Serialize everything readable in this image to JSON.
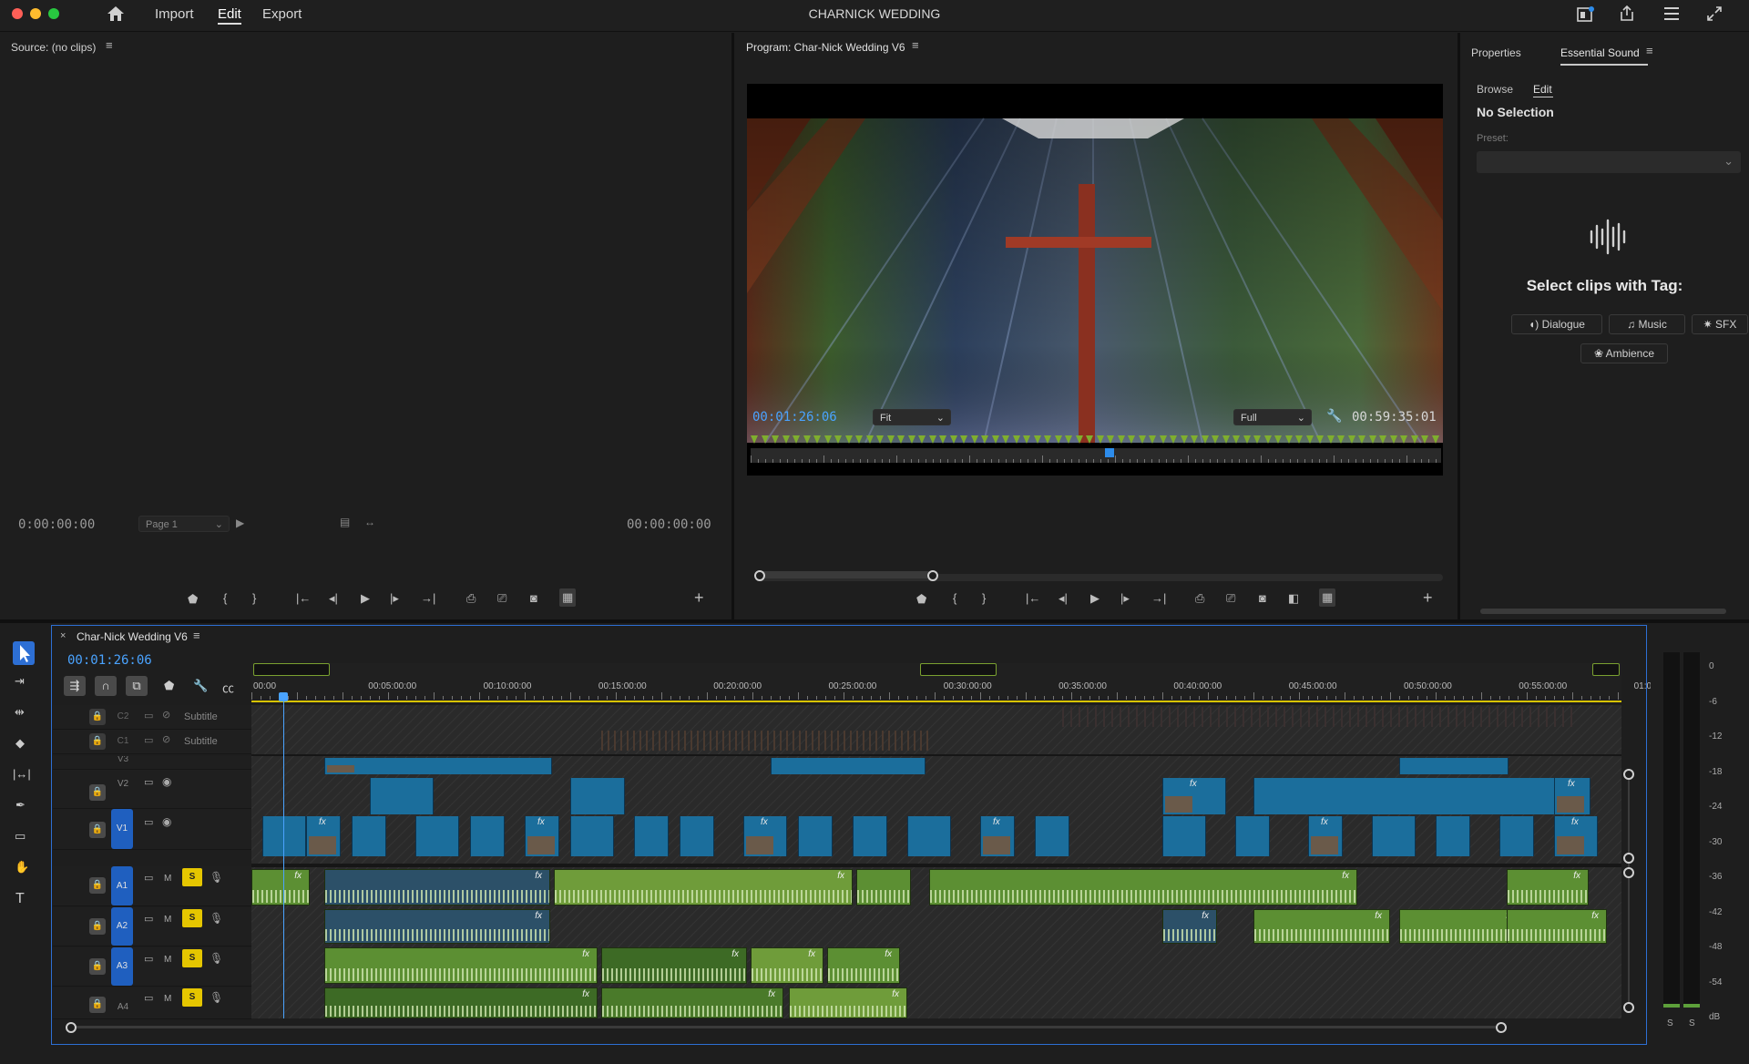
{
  "titlebar": {
    "menu": {
      "import": "Import",
      "edit": "Edit",
      "export": "Export"
    },
    "project_title": "CHARNICK WEDDING",
    "icons": [
      "home-icon",
      "quick-export-icon",
      "share-icon",
      "workspaces-icon",
      "fullscreen-icon"
    ]
  },
  "source_monitor": {
    "title": "Source: (no clips)",
    "timecode_in": "0:00:00:00",
    "timecode_out": "00:00:00:00",
    "page_dropdown": "Page 1"
  },
  "program_monitor": {
    "title": "Program: Char-Nick Wedding V6",
    "timecode_current": "00:01:26:06",
    "zoom_dropdown": "Fit",
    "resolution_dropdown": "Full",
    "duration": "00:59:35:01",
    "playhead_fraction": 0.52
  },
  "essential_sound": {
    "tabs": {
      "properties": "Properties",
      "essential_sound": "Essential Sound"
    },
    "subtabs": {
      "browse": "Browse",
      "edit": "Edit"
    },
    "no_selection": "No Selection",
    "preset_label": "Preset:",
    "select_heading": "Select clips with Tag:",
    "tags": {
      "dialogue": "Dialogue",
      "music": "Music",
      "sfx": "SFX",
      "ambience": "Ambience"
    }
  },
  "timeline": {
    "sequence_tab": "Char-Nick Wedding V6",
    "timecode": "00:01:26:06",
    "ruler_labels": [
      "00:00",
      "00:05:00:00",
      "00:10:00:00",
      "00:15:00:00",
      "00:20:00:00",
      "00:25:00:00",
      "00:30:00:00",
      "00:35:00:00",
      "00:40:00:00",
      "00:45:00:00",
      "00:50:00:00",
      "00:55:00:00",
      "01:0"
    ],
    "tracks": {
      "c2": {
        "name": "C2",
        "label": "Subtitle"
      },
      "c1": {
        "name": "C1",
        "label": "Subtitle"
      },
      "v3": {
        "name": "V3"
      },
      "v2": {
        "name": "V2"
      },
      "v1": {
        "name": "V1"
      },
      "a1": {
        "name": "A1",
        "m": "M",
        "s": "S"
      },
      "a2": {
        "name": "A2",
        "m": "M",
        "s": "S"
      },
      "a3": {
        "name": "A3",
        "m": "M",
        "s": "S"
      },
      "a4": {
        "name": "A4",
        "m": "M",
        "s": "S"
      }
    },
    "clip_labels": {
      "fx": "fx"
    }
  },
  "audio_meter": {
    "scale": [
      "0",
      "-6",
      "-12",
      "-18",
      "-24",
      "-30",
      "-36",
      "-42",
      "-48",
      "-54",
      "dB"
    ],
    "solo_labels": [
      "S",
      "S"
    ]
  },
  "colors": {
    "accent_blue": "#2d8ceb",
    "timecode_blue": "#4aa3ff",
    "video_clip": "#1b6e9c",
    "audio_clip": "#5c8f33",
    "solo_yellow": "#e5c600",
    "track_target": "#1f5fbf"
  }
}
